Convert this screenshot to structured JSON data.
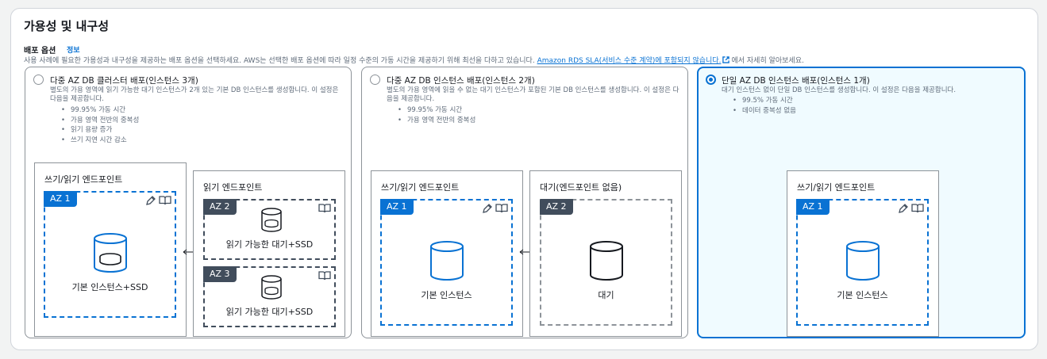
{
  "section": {
    "title": "가용성 및 내구성",
    "label": "배포 옵션",
    "info_link": "정보",
    "description_before": "사용 사례에 필요한 가용성과 내구성을 제공하는 배포 옵션을 선택하세요. AWS는 선택한 배포 옵션에 따라 일정 수준의 가동 시간을 제공하기 위해 최선을 다하고 있습니다.",
    "sla_link": "Amazon RDS SLA(서비스 수준 계약)에 포함되지 않습니다.",
    "description_after": "에서 자세히 알아보세요."
  },
  "options": [
    {
      "title": "다중 AZ DB 클러스터 배포(인스턴스 3개)",
      "selected": false,
      "description": "별도의 가용 영역에 읽기 가능한 대기 인스턴스가 2개 있는 기본 DB 인스턴스를 생성합니다. 이 설정은 다음을 제공합니다.",
      "bullets": [
        "99.95% 가동 시간",
        "가용 영역 전반의 중복성",
        "읽기 용량 증가",
        "쓰기 지연 시간 감소"
      ],
      "diagram": {
        "write_title": "쓰기/읽기 엔드포인트",
        "read_title": "읽기 엔드포인트",
        "az1": "AZ 1",
        "az1_label": "기본 인스턴스+SSD",
        "az2": "AZ 2",
        "az2_label": "읽기 가능한 대기+SSD",
        "az3": "AZ 3",
        "az3_label": "읽기 가능한 대기+SSD"
      }
    },
    {
      "title": "다중 AZ DB 인스턴스 배포(인스턴스 2개)",
      "selected": false,
      "description": "별도의 가용 영역에 읽을 수 없는 대기 인스턴스가 포함된 기본 DB 인스턴스를 생성합니다. 이 설정은 다음을 제공합니다.",
      "bullets": [
        "99.95% 가동 시간",
        "가용 영역 전반의 중복성"
      ],
      "diagram": {
        "write_title": "쓰기/읽기 엔드포인트",
        "standby_title": "대기(엔드포인트 없음)",
        "az1": "AZ 1",
        "az1_label": "기본 인스턴스",
        "az2": "AZ 2",
        "az2_label": "대기"
      }
    },
    {
      "title": "단일 AZ DB 인스턴스 배포(인스턴스 1개)",
      "selected": true,
      "description": "대기 인스턴스 없이 단일 DB 인스턴스를 생성합니다. 이 설정은 다음을 제공합니다.",
      "bullets": [
        "99.5% 가동 시간",
        "데이터 중복성 없음"
      ],
      "diagram": {
        "write_title": "쓰기/읽기 엔드포인트",
        "az1": "AZ 1",
        "az1_label": "기본 인스턴스"
      }
    }
  ],
  "colors": {
    "accent": "#0972d3",
    "selected_bg": "#f0fbff",
    "dark_badge": "#414d5c",
    "muted_text": "#5f6b7a"
  }
}
